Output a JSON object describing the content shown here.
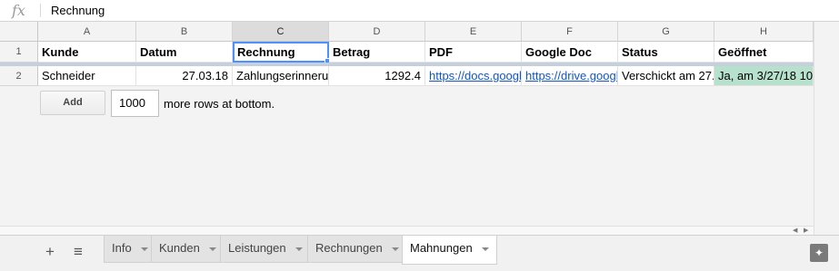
{
  "formula_bar": {
    "fx_label": "fx",
    "value": "Rechnung"
  },
  "columns": [
    "A",
    "B",
    "C",
    "D",
    "E",
    "F",
    "G",
    "H"
  ],
  "selected_column": "C",
  "rows": [
    {
      "number": "1",
      "cells": [
        "Kunde",
        "Datum",
        "Rechnung",
        "Betrag",
        "PDF",
        "Google Doc",
        "Status",
        "Geöffnet"
      ]
    },
    {
      "number": "2",
      "cells": [
        "Schneider",
        "27.03.18",
        "Zahlungserinneru",
        "1292.4",
        "https://docs.googl",
        "https://drive.googl",
        "Verschickt am 27.",
        "Ja, am 3/27/18 10"
      ]
    }
  ],
  "add_rows": {
    "button_label": "Add",
    "count_value": "1000",
    "suffix_text": "more rows at bottom."
  },
  "sheet_tabs": [
    {
      "label": "Info",
      "active": false
    },
    {
      "label": "Kunden",
      "active": false
    },
    {
      "label": "Leistungen",
      "active": false
    },
    {
      "label": "Rechnungen",
      "active": false
    },
    {
      "label": "Mahnungen",
      "active": true
    }
  ],
  "colors": {
    "accent": "#4d90fe",
    "link": "#1155cc",
    "opened_cell": "#b7e1cd"
  },
  "icons": {
    "add_sheet": "plus-icon",
    "all_sheets": "list-icon",
    "explore": "explore-icon"
  }
}
